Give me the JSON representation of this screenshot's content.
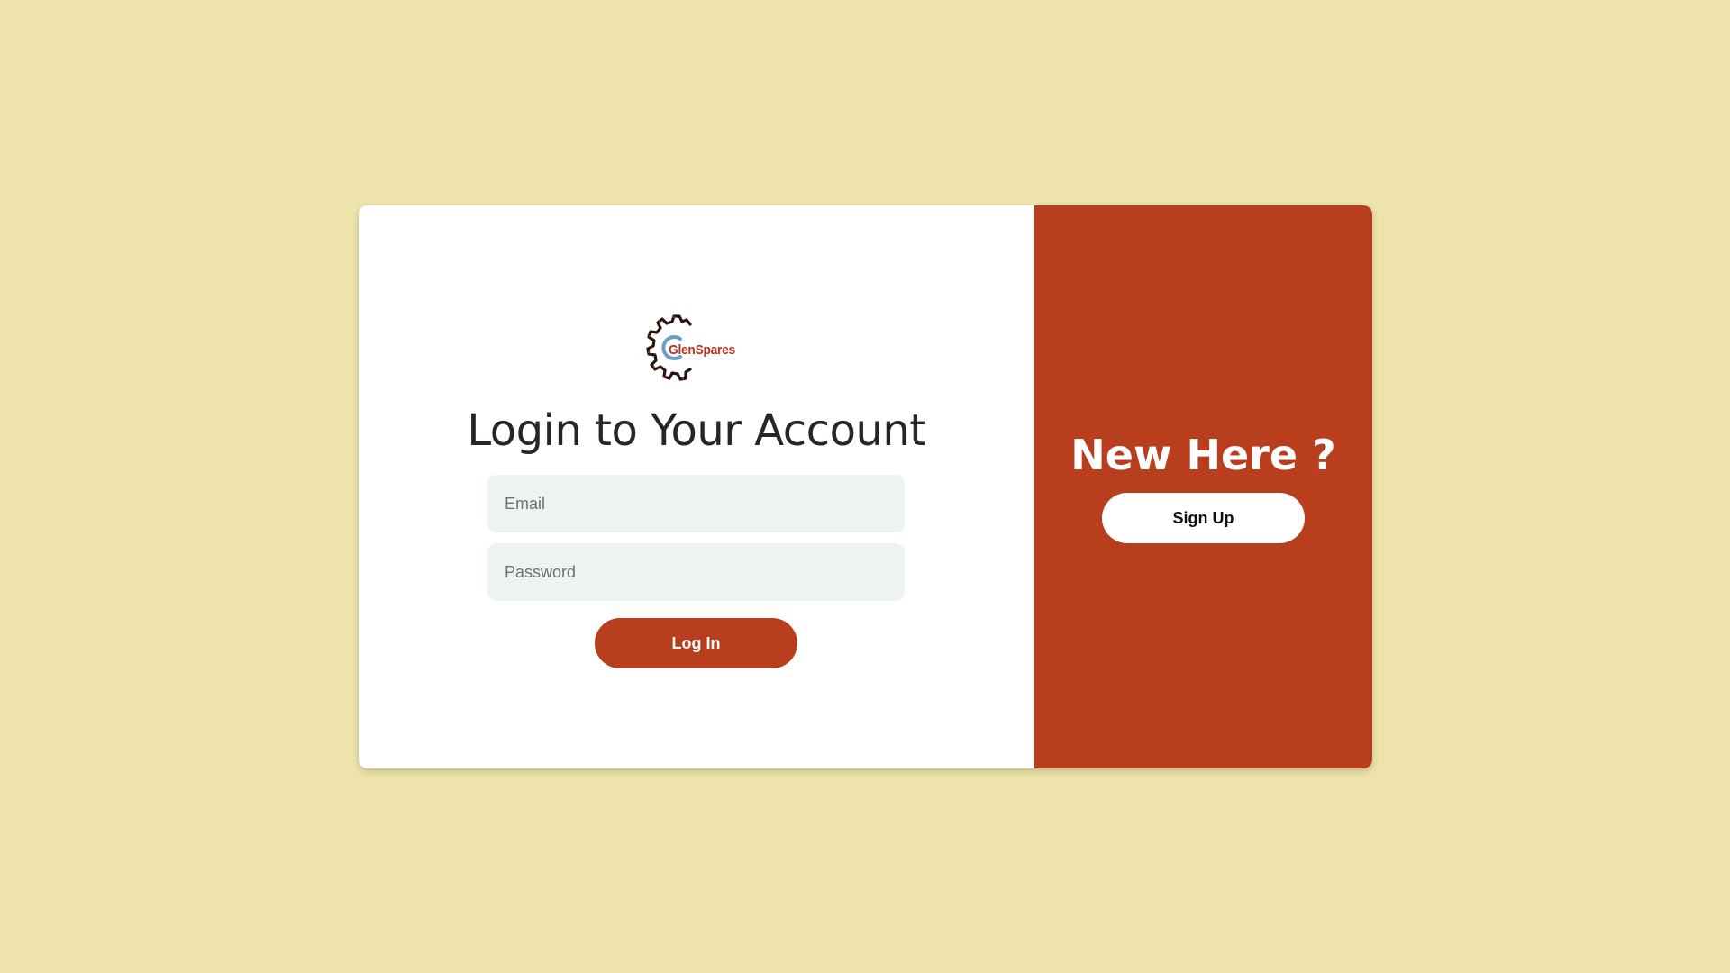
{
  "brand": {
    "logo_text": "GlenSpares",
    "logo_icon": "gear-icon"
  },
  "login": {
    "title": "Login to Your Account",
    "email_placeholder": "Email",
    "email_value": "",
    "password_placeholder": "Password",
    "password_value": "",
    "submit_label": "Log In"
  },
  "signup": {
    "heading": "New Here ?",
    "button_label": "Sign Up"
  },
  "colors": {
    "page_background": "#ede3ab",
    "accent": "#b83e1e",
    "input_background": "#ecf3f0",
    "panel_background": "#ffffff"
  }
}
